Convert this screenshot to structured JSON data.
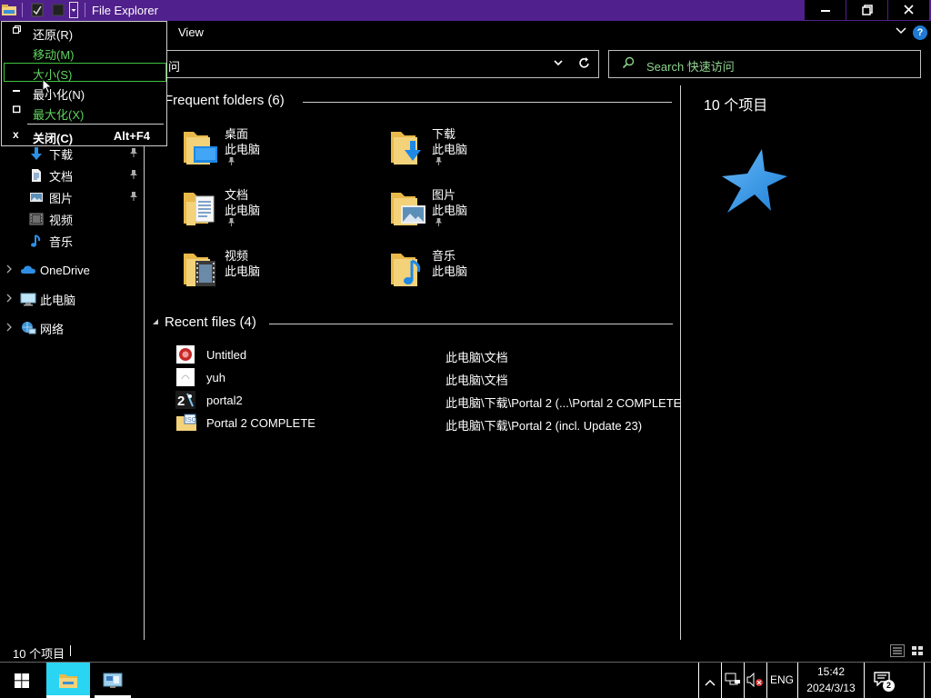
{
  "window": {
    "title": "File Explorer",
    "minimize_glyph": "—",
    "restore_glyph": "❐",
    "close_glyph": "✕"
  },
  "ribbon": {
    "view_tab": "View",
    "expand_glyph": "⌄",
    "help_glyph": "?"
  },
  "address": {
    "text": "问",
    "dropdown_glyph": "⌄",
    "refresh_glyph": "↻"
  },
  "search": {
    "placeholder": "Search 快速访问",
    "icon": "search-icon"
  },
  "sidebar": {
    "items": [
      {
        "label": "下载",
        "icon": "download-arrow-icon",
        "pinned": true
      },
      {
        "label": "文档",
        "icon": "document-icon",
        "pinned": true
      },
      {
        "label": "图片",
        "icon": "pictures-icon",
        "pinned": true
      },
      {
        "label": "视频",
        "icon": "videos-icon",
        "pinned": false
      },
      {
        "label": "音乐",
        "icon": "music-note-icon",
        "pinned": false
      },
      {
        "label": "OneDrive",
        "icon": "cloud-icon",
        "expandable": true
      },
      {
        "label": "此电脑",
        "icon": "computer-icon",
        "expandable": true
      },
      {
        "label": "网络",
        "icon": "network-icon",
        "expandable": true
      }
    ],
    "pin_glyph": "📌",
    "chevron_glyph": "›"
  },
  "frequent": {
    "header": "Frequent folders (6)",
    "folders": [
      {
        "name": "桌面",
        "location": "此电脑",
        "pinned": true,
        "icon": "desktop-folder-icon"
      },
      {
        "name": "下载",
        "location": "此电脑",
        "pinned": true,
        "icon": "downloads-folder-icon"
      },
      {
        "name": "文档",
        "location": "此电脑",
        "pinned": true,
        "icon": "documents-folder-icon"
      },
      {
        "name": "图片",
        "location": "此电脑",
        "pinned": true,
        "icon": "pictures-folder-icon"
      },
      {
        "name": "视频",
        "location": "此电脑",
        "pinned": false,
        "icon": "videos-folder-icon"
      },
      {
        "name": "音乐",
        "location": "此电脑",
        "pinned": false,
        "icon": "music-folder-icon"
      }
    ]
  },
  "recent": {
    "header": "Recent files (4)",
    "files": [
      {
        "name": "Untitled",
        "path": "此电脑\\文档",
        "icon": "red-circle-file-icon"
      },
      {
        "name": "yuh",
        "path": "此电脑\\文档",
        "icon": "blank-image-file-icon"
      },
      {
        "name": "portal2",
        "path": "此电脑\\下载\\Portal 2 (...\\Portal 2 COMPLETE",
        "icon": "portal2-app-icon"
      },
      {
        "name": "Portal 2 COMPLETE",
        "path": "此电脑\\下载\\Portal 2 (incl. Update 23)",
        "icon": "iso-disc-folder-icon"
      }
    ]
  },
  "details": {
    "title": "10 个项目",
    "icon": "star-icon"
  },
  "status": {
    "count": "10 个项目"
  },
  "system_menu": {
    "items": [
      {
        "label": "还原(R)",
        "glyph": "▣",
        "enabled": true
      },
      {
        "label": "移动(M)",
        "glyph": "",
        "enabled": false
      },
      {
        "label": "大小(S)",
        "glyph": "",
        "enabled": false,
        "selected": true
      },
      {
        "label": "最小化(N)",
        "glyph": "▬",
        "enabled": true
      },
      {
        "label": "最大化(X)",
        "glyph": "▢",
        "enabled": false
      },
      {
        "label": "关闭(C)",
        "glyph": "x",
        "accel": "Alt+F4",
        "enabled": true,
        "bold": true
      }
    ]
  },
  "taskbar": {
    "apps": [
      "start-button",
      "file-explorer-app",
      "control-panel-app"
    ],
    "tray": {
      "chevron_glyph": "^",
      "language": "ENG",
      "time": "15:42",
      "date": "2024/3/13",
      "notification_count": "2"
    }
  },
  "colors": {
    "titlebar": "#50208c",
    "accent_green": "#5fd35f",
    "taskbar_active": "#2ad4f3",
    "folder_yellow": "#f3d27a",
    "star_blue": "#2e9bf0"
  }
}
